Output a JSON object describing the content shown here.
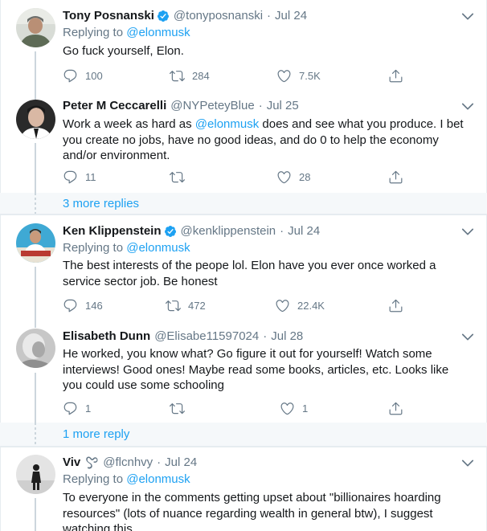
{
  "tweets": [
    {
      "name": "Tony Posnanski",
      "verified": true,
      "handle": "@tonyposnanski",
      "date": "Jul 24",
      "replying_prefix": "Replying to",
      "replying_to": "@elonmusk",
      "text": "Go fuck yourself, Elon.",
      "replies": "100",
      "retweets": "284",
      "likes": "7.5K"
    },
    {
      "name": "Peter M Ceccarelli",
      "verified": false,
      "handle": "@NYPeteyBlue",
      "date": "Jul 25",
      "text_before": "Work a week as hard as ",
      "text_mention": "@elonmusk",
      "text_after": " does and see what you produce. I bet you create no jobs, have no good ideas, and do 0 to help the economy and/or environment.",
      "replies": "11",
      "retweets": "",
      "likes": "28"
    },
    {
      "name": "Ken Klippenstein",
      "verified": true,
      "handle": "@kenklippenstein",
      "date": "Jul 24",
      "replying_prefix": "Replying to",
      "replying_to": "@elonmusk",
      "text": "The best interests of the peope lol. Elon have you ever once worked a service sector job. Be honest",
      "replies": "146",
      "retweets": "472",
      "likes": "22.4K"
    },
    {
      "name": "Elisabeth Dunn",
      "verified": false,
      "handle": "@Elisabe11597024",
      "date": "Jul 28",
      "text": "He worked, you know what? Go figure it out for yourself! Watch some interviews! Good ones! Maybe read some books, articles, etc. Looks like you could use some schooling",
      "replies": "1",
      "retweets": "",
      "likes": "1"
    },
    {
      "name": "Viv",
      "verified": false,
      "handle": "@flcnhvy",
      "date": "Jul 24",
      "replying_prefix": "Replying to",
      "replying_to": "@elonmusk",
      "text": "To everyone in the comments getting upset about \"billionaires hoarding resources\" (lots of nuance regarding wealth in general btw), I suggest watching this"
    }
  ],
  "more_replies": [
    "3 more replies",
    "1 more reply"
  ],
  "colors": {
    "accent": "#1da1f2",
    "secondary_text": "#657786",
    "retweet_green": "#17bf63"
  },
  "icons": [
    "reply-icon",
    "retweet-icon",
    "like-icon",
    "share-icon",
    "verified-badge-icon",
    "chevron-down-icon"
  ]
}
